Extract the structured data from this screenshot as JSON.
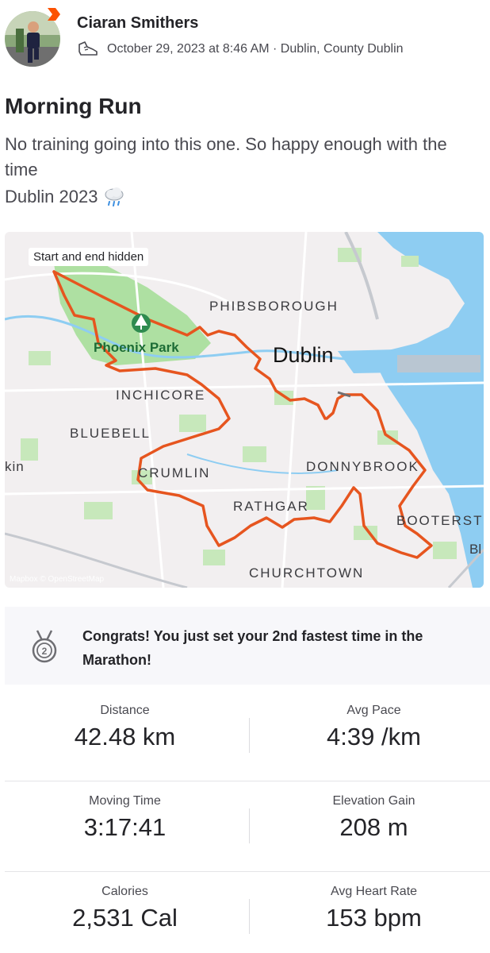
{
  "athlete": {
    "name": "Ciaran Smithers",
    "meta": "October 29, 2023 at 8:46 AM · Dublin, County Dublin"
  },
  "activity": {
    "title": "Morning Run",
    "description_line1": "No training going into this one. So happy enough with the time",
    "description_line2": "Dublin 2023",
    "weather_icon": "rain-cloud-icon"
  },
  "map": {
    "privacy_note": "Start and end hidden",
    "labels": {
      "phibsborough": "PHIBSBOROUGH",
      "dublin": "Dublin",
      "phoenix_park": "Phoenix Park",
      "inchicore": "INCHICORE",
      "bluebell": "BLUEBELL",
      "kin": "kin",
      "crumlin": "CRUMLIN",
      "donnybrook": "DONNYBROOK",
      "rathgar": "RATHGAR",
      "booterstown": "BOOTERST",
      "bl": "Bl",
      "churchtown": "CHURCHTOWN"
    },
    "attribution": "Mapbox © OpenStreetMap",
    "route_color": "#e6551f",
    "park_icon": "tree-icon"
  },
  "achievement": {
    "text": "Congrats! You just set your 2nd fastest time in the Marathon!",
    "icon": "medal-icon"
  },
  "stats": [
    {
      "label": "Distance",
      "value": "42.48 km"
    },
    {
      "label": "Avg Pace",
      "value": "4:39 /km"
    },
    {
      "label": "Moving Time",
      "value": "3:17:41"
    },
    {
      "label": "Elevation Gain",
      "value": "208 m"
    },
    {
      "label": "Calories",
      "value": "2,531 Cal"
    },
    {
      "label": "Avg Heart Rate",
      "value": "153 bpm"
    }
  ],
  "colors": {
    "brand": "#fc5200",
    "text": "#242428",
    "muted": "#494950"
  }
}
